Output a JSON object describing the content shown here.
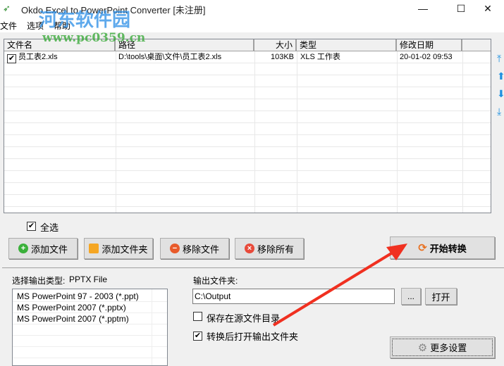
{
  "window": {
    "title": "Okdo Excel to PowerPoint Converter [未注册]",
    "minimize": "—",
    "maximize": "☐",
    "close": "✕"
  },
  "menu": [
    "文件",
    "选项",
    "帮助"
  ],
  "watermark": {
    "name": "河东软件园",
    "url": "www.pc0359.cn"
  },
  "file_list": {
    "columns": [
      "文件名",
      "路径",
      "大小",
      "类型",
      "修改日期"
    ],
    "rows": [
      {
        "checked": true,
        "name": "员工表2.xls",
        "path": "D:\\tools\\桌面\\文件\\员工表2.xls",
        "size": "103KB",
        "type": "XLS 工作表",
        "modified": "20-01-02 09:53"
      }
    ]
  },
  "select_all": {
    "label": "全选",
    "checked": true
  },
  "buttons": {
    "add_file": "添加文件",
    "add_folder": "添加文件夹",
    "remove_file": "移除文件",
    "remove_all": "移除所有",
    "start": "开始转换",
    "browse": "...",
    "open": "打开",
    "more_settings": "更多设置"
  },
  "output": {
    "type_label": "选择输出类型:",
    "type_value": "PPTX File",
    "formats": [
      "MS PowerPoint 97 - 2003 (*.ppt)",
      "MS PowerPoint 2007 (*.pptx)",
      "MS PowerPoint 2007 (*.pptm)"
    ],
    "folder_label": "输出文件夹:",
    "folder_value": "C:\\Output",
    "save_in_source": {
      "label": "保存在源文件目录",
      "checked": false
    },
    "open_after": {
      "label": "转换后打开输出文件夹",
      "checked": true
    }
  },
  "colors": {
    "annotation_arrow": "#f03020"
  }
}
